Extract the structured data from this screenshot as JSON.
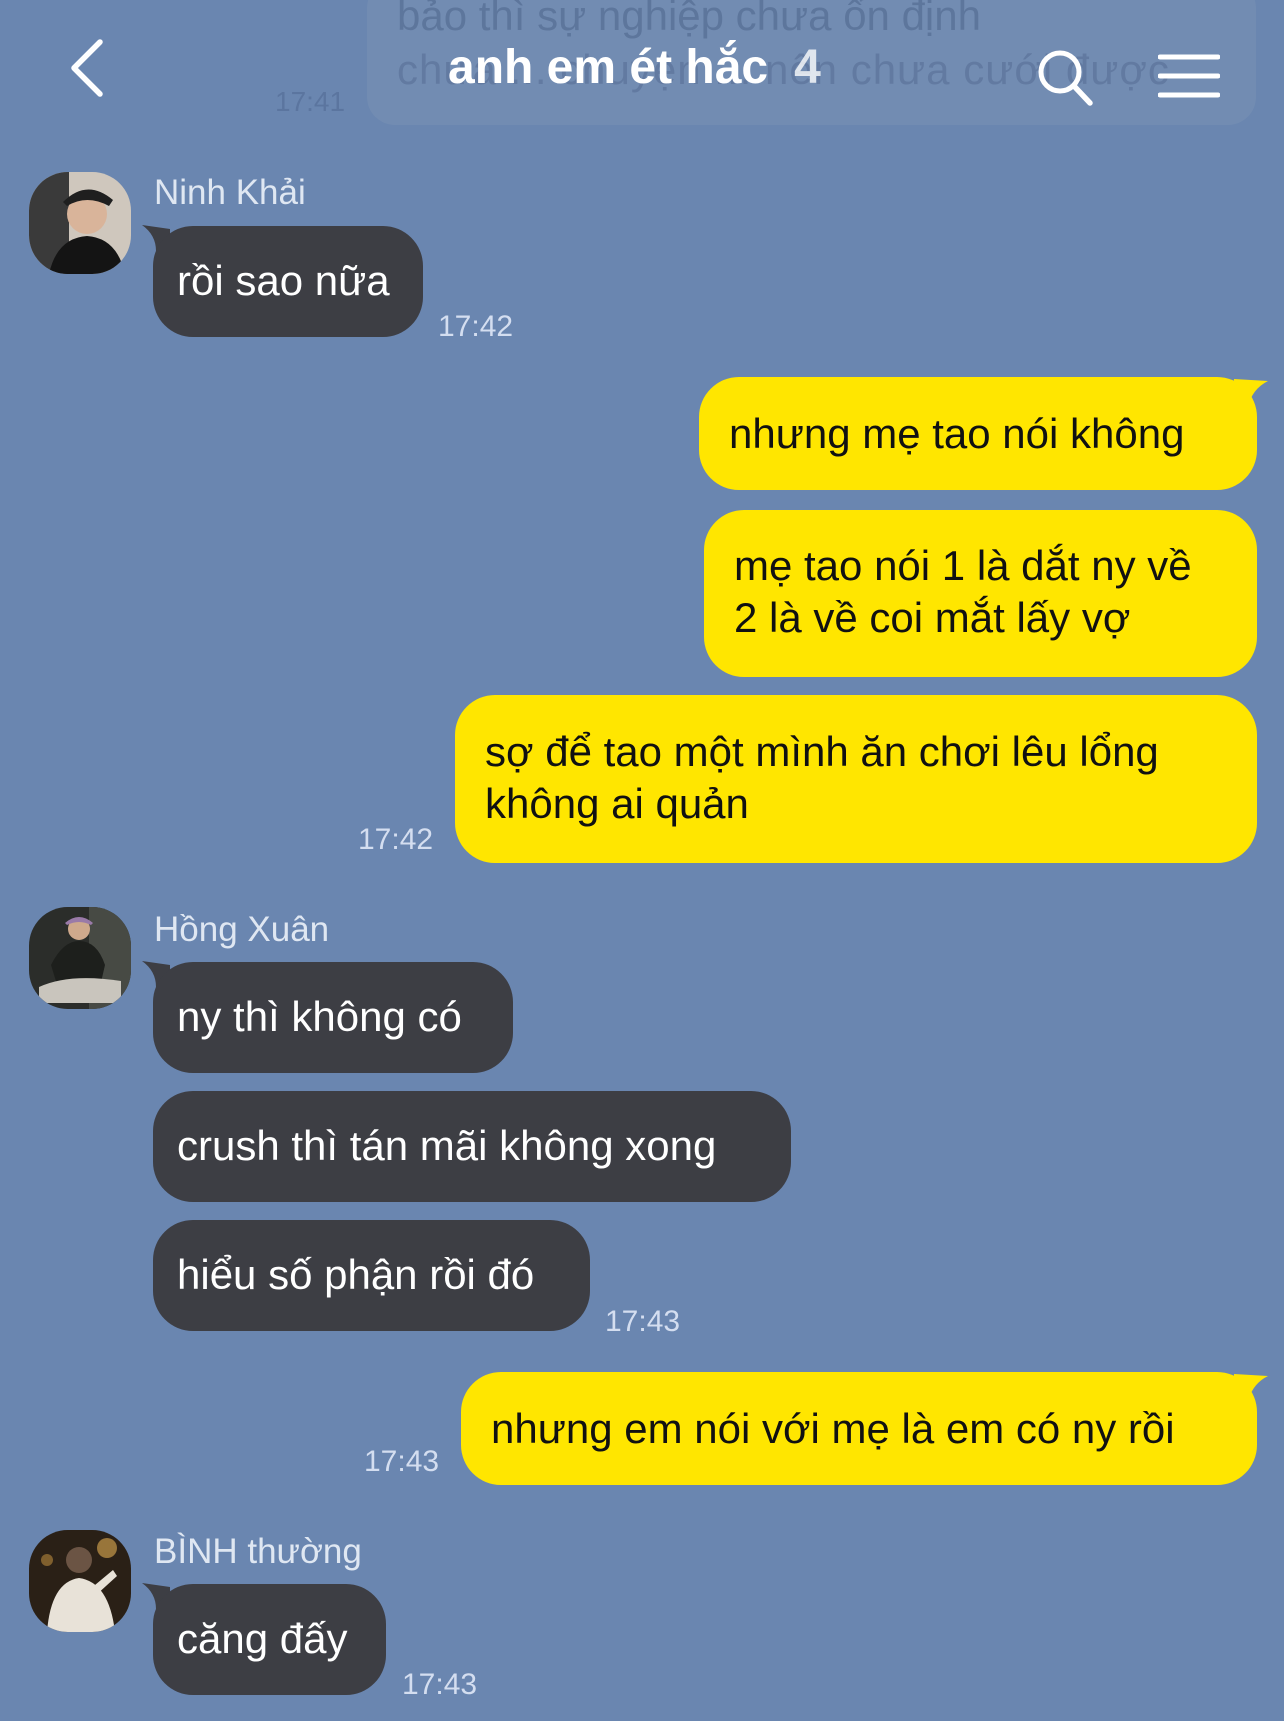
{
  "header": {
    "title": "anh em ét hắc",
    "member_count": "4"
  },
  "background_ghost": {
    "line1": "bảo thì sự nghiệp chưa ổn định",
    "line2": "chưa ... chuyện ... nên chưa cưới được",
    "time": "17:41"
  },
  "messages": {
    "m1": {
      "sender": "Ninh Khải",
      "text": "rồi sao nữa",
      "time": "17:42"
    },
    "m2": {
      "text": "nhưng mẹ tao nói không"
    },
    "m3": {
      "line1": "mẹ tao nói 1 là dắt ny về",
      "line2": "2 là về coi mắt lấy vợ"
    },
    "m4": {
      "line1": "sợ để tao một mình ăn chơi lêu lổng",
      "line2": "không ai quản",
      "time": "17:42"
    },
    "m5": {
      "sender": "Hồng Xuân",
      "text": "ny thì không có"
    },
    "m6": {
      "text": "crush thì tán mãi không xong"
    },
    "m7": {
      "text": "hiểu số phận rồi đó",
      "time": "17:43"
    },
    "m8": {
      "text": "nhưng em nói với mẹ là em có ny rồi",
      "time": "17:43"
    },
    "m9": {
      "sender": "BÌNH thường",
      "text": "căng đấy",
      "time": "17:43"
    }
  },
  "colors": {
    "background": "#6a86b0",
    "incoming_bubble": "#3d3e44",
    "outgoing_bubble": "#ffe600"
  }
}
